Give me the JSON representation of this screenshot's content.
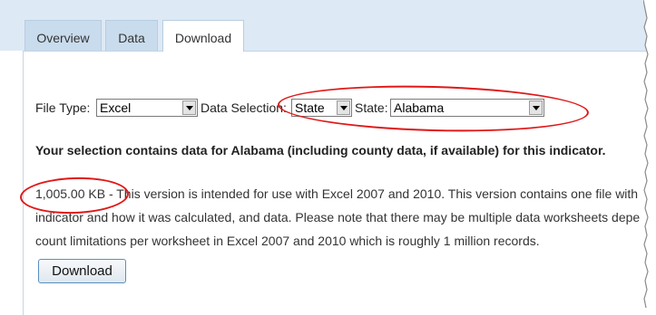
{
  "tabs": [
    {
      "label": "Overview",
      "active": false
    },
    {
      "label": "Data",
      "active": false
    },
    {
      "label": "Download",
      "active": true
    }
  ],
  "form": {
    "file_type_label": "File Type:",
    "file_type_value": "Excel",
    "data_selection_label": "Data Selection:",
    "data_selection_value": "State",
    "state_label": "State:",
    "state_value": "Alabama"
  },
  "selection_note": "Your selection contains data for Alabama (including county data, if available) for this indicator.",
  "description": {
    "line1": "1,005.00 KB - This version is intended for use with Excel 2007 and 2010. This version contains one file with",
    "line2": "indicator and how it was calculated, and data. Please note that there may be multiple data worksheets depe",
    "line3": "count limitations per worksheet in Excel 2007 and 2010 which is roughly 1 million records."
  },
  "download_button_label": "Download",
  "colors": {
    "annotation": "#e01818",
    "tab_bg": "#dde9f5",
    "button_border": "#5b8fc0"
  }
}
